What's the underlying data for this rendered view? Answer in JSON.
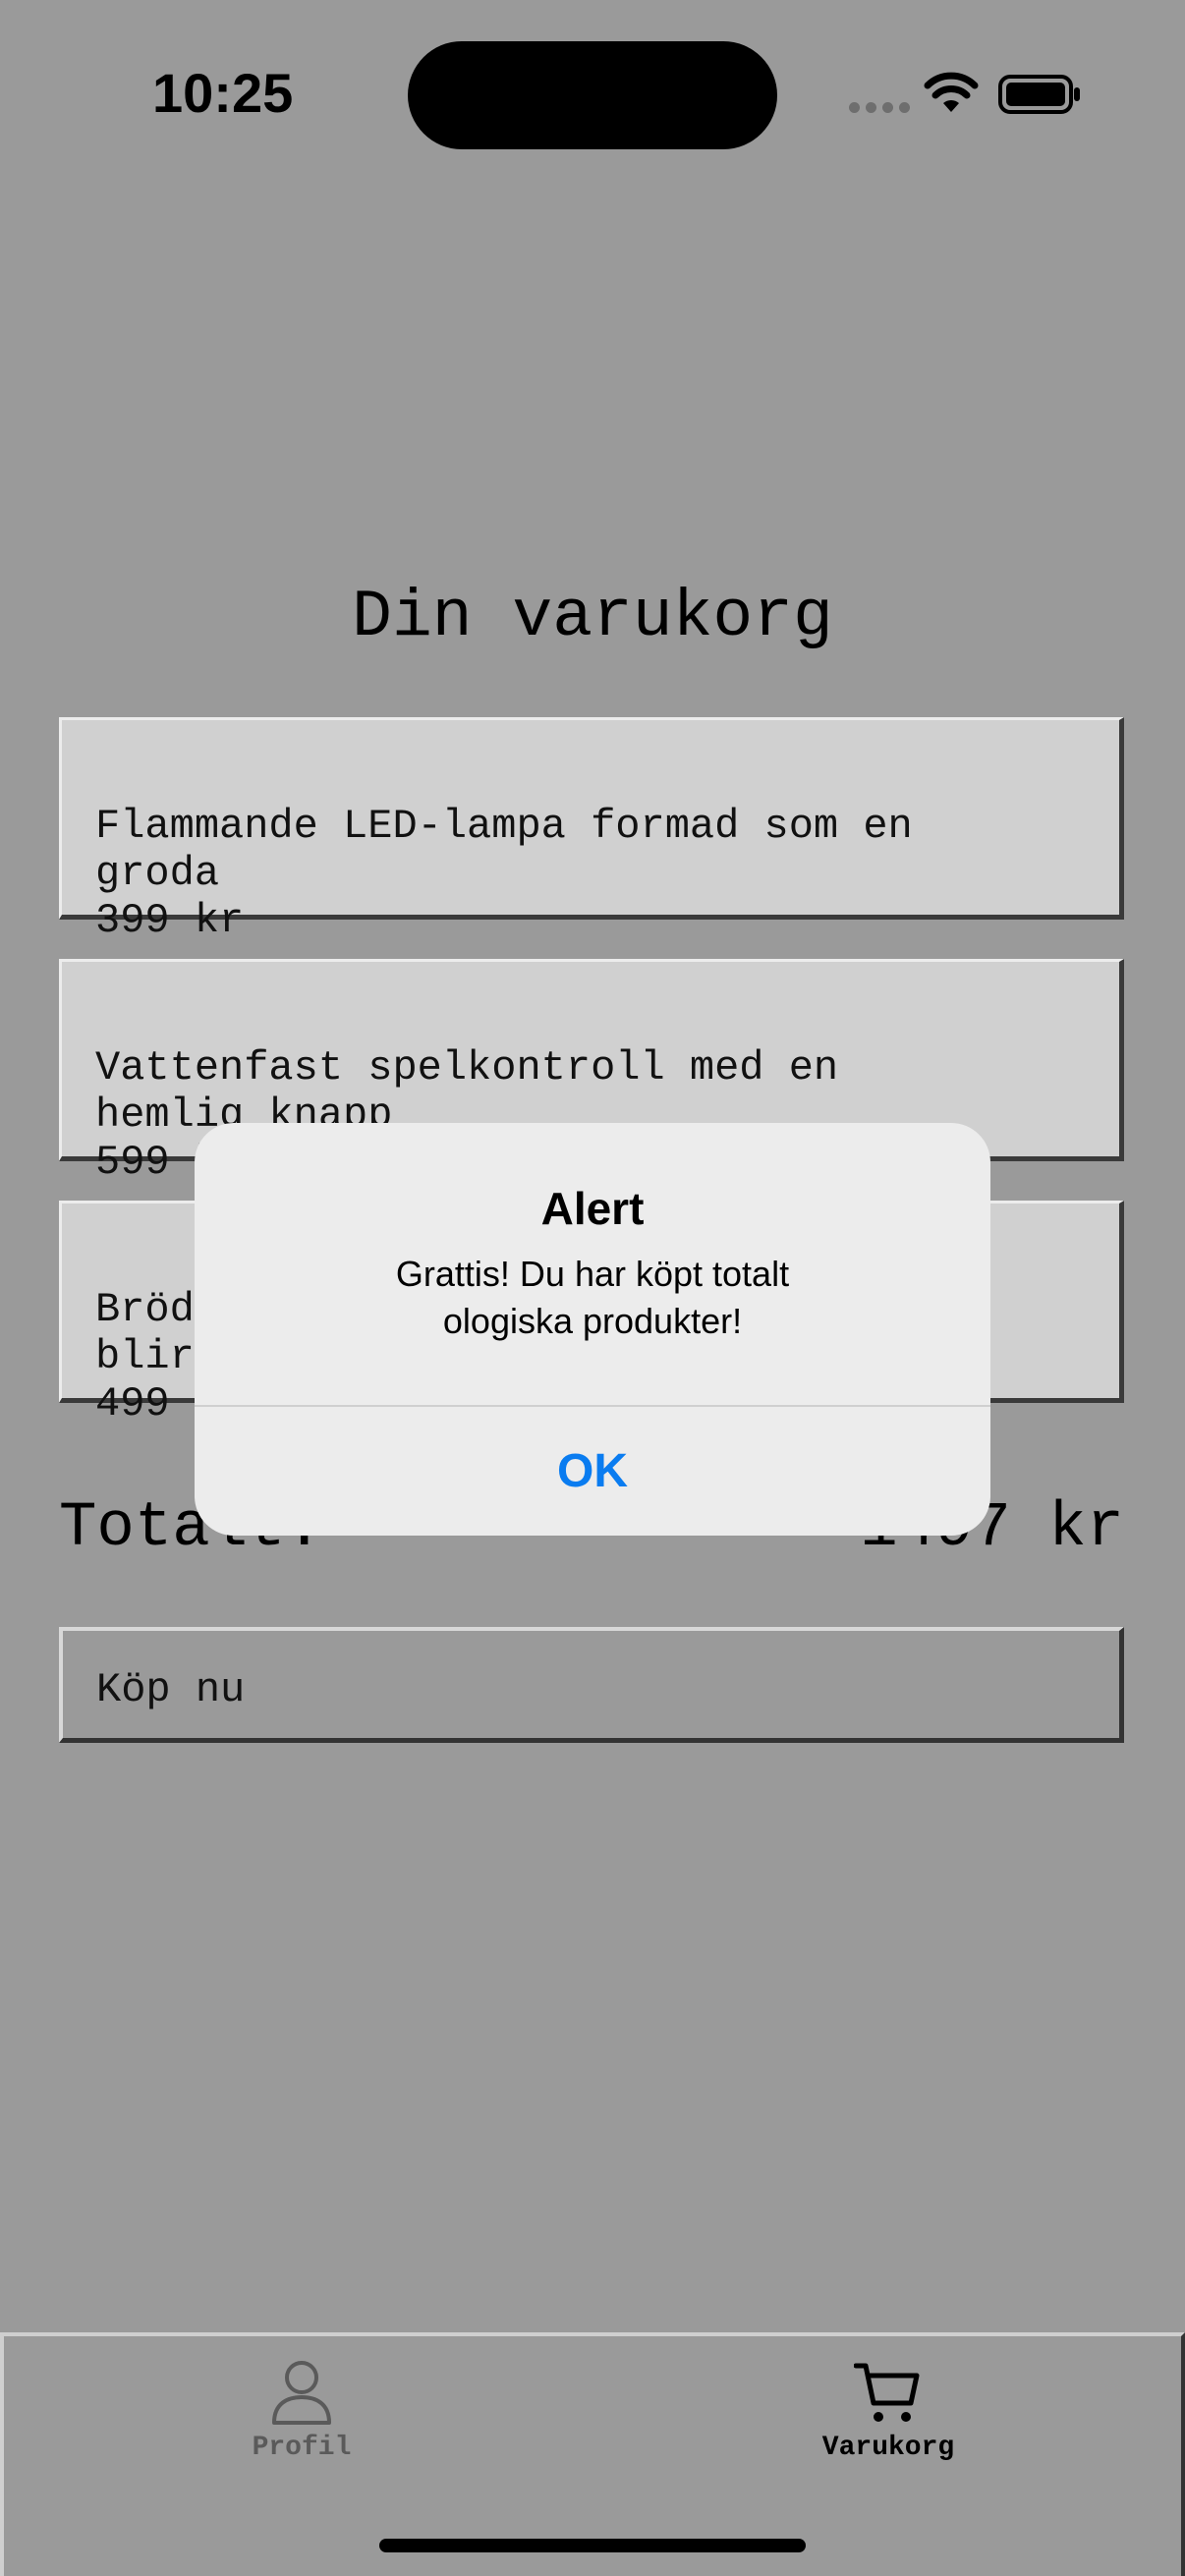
{
  "status_bar": {
    "time": "10:25"
  },
  "page": {
    "title": "Din varukorg"
  },
  "cart": {
    "items": [
      {
        "name": "Flammande LED-lampa formad som en\ngroda",
        "price": "399 kr"
      },
      {
        "name": "Vattenfast spelkontroll med en\nhemlig knapp",
        "price": "599 kr"
      },
      {
        "name": "Bröd                                  och\nblir",
        "price": "499"
      }
    ],
    "total_label": "Totalt:",
    "total_value": "1497 kr",
    "buy_label": "Köp nu"
  },
  "alert": {
    "title": "Alert",
    "message": "Grattis! Du har köpt totalt\nologiska produkter!",
    "ok_label": "OK"
  },
  "tabbar": {
    "tabs": [
      {
        "label": "Profil",
        "icon": "person-icon",
        "active": false
      },
      {
        "label": "Varukorg",
        "icon": "cart-icon",
        "active": true
      }
    ]
  },
  "colors": {
    "accent": "#0A7CF0",
    "background": "#9A9A9A",
    "card": "#D0D0D0"
  }
}
